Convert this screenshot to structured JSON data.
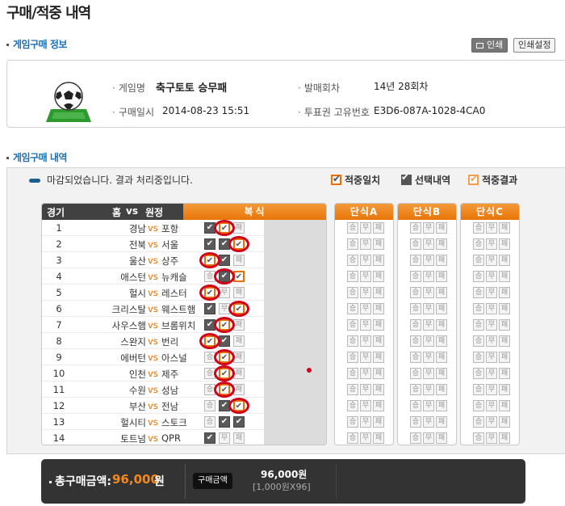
{
  "page_title": "구매/적중 내역",
  "section_purchase_info": "게임구매 정보",
  "btn_print": "인쇄",
  "btn_print_setup": "인쇄설정",
  "info": {
    "game_name_label": "게임명",
    "game_name_value": "축구토토 승무패",
    "round_label": "발매회차",
    "round_value": "14년 28회차",
    "purchase_date_label": "구매일시",
    "purchase_date_value": "2014-08-23 15:51",
    "ticket_id_label": "투표권 고유번호",
    "ticket_id_value": "E3D6-087A-1028-4CA0"
  },
  "section_purchase_detail": "게임구매 내역",
  "notice": "마감되었습니다. 결과 처리중입니다.",
  "legend": {
    "hit": "적중일치",
    "selected": "선택내역",
    "hit_result": "적중결과"
  },
  "table": {
    "col_no": "경기",
    "col_home": "홈",
    "col_vs": "vs",
    "col_away": "원정",
    "col_multi": "복식",
    "col_single_a": "단식A",
    "col_single_b": "단식B",
    "col_single_c": "단식C",
    "vs_text": "vs",
    "mark_win": "승",
    "mark_draw": "무",
    "mark_loss": "패"
  },
  "rows": [
    {
      "no": "1",
      "home": "경남",
      "away": "포항",
      "marks": [
        "sel",
        "hit",
        "empty"
      ],
      "circle": 1
    },
    {
      "no": "2",
      "home": "전북",
      "away": "서울",
      "marks": [
        "sel",
        "sel",
        "hit"
      ],
      "circle": 2
    },
    {
      "no": "3",
      "home": "울산",
      "away": "상주",
      "marks": [
        "hit",
        "sel",
        "empty"
      ],
      "circle": 0
    },
    {
      "no": "4",
      "home": "애스턴",
      "away": "뉴캐슬",
      "marks": [
        "empty",
        "sel",
        "hit"
      ],
      "circle": 1
    },
    {
      "no": "5",
      "home": "헐시",
      "away": "레스터",
      "marks": [
        "hit",
        "empty",
        "empty"
      ],
      "circle": 0
    },
    {
      "no": "6",
      "home": "크리스탈",
      "away": "웨스트햄",
      "marks": [
        "sel",
        "empty",
        "hit"
      ],
      "circle": 2
    },
    {
      "no": "7",
      "home": "사우스햄",
      "away": "브롬위치",
      "marks": [
        "sel",
        "hit",
        "empty"
      ],
      "circle": 1
    },
    {
      "no": "8",
      "home": "스완지",
      "away": "번리",
      "marks": [
        "hit",
        "sel",
        "empty"
      ],
      "circle": 0
    },
    {
      "no": "9",
      "home": "에버턴",
      "away": "아스널",
      "marks": [
        "empty",
        "hit",
        "empty"
      ],
      "circle": 1
    },
    {
      "no": "10",
      "home": "인천",
      "away": "제주",
      "marks": [
        "empty",
        "hit",
        "empty"
      ],
      "circle": 1
    },
    {
      "no": "11",
      "home": "수원",
      "away": "성남",
      "marks": [
        "empty",
        "hit",
        "empty"
      ],
      "circle": 1
    },
    {
      "no": "12",
      "home": "부산",
      "away": "전남",
      "marks": [
        "empty",
        "sel",
        "hit"
      ],
      "circle": 2
    },
    {
      "no": "13",
      "home": "헐시티",
      "away": "스토크",
      "marks": [
        "empty",
        "sel",
        "sel"
      ],
      "circle": -1
    },
    {
      "no": "14",
      "home": "토트넘",
      "away": "QPR",
      "marks": [
        "sel",
        "empty",
        "empty"
      ],
      "circle": -1
    }
  ],
  "total": {
    "label": "총구매금액:",
    "amount": "96,000",
    "unit": "원",
    "badge": "구매금액",
    "value": "96,000원",
    "breakdown": "[1,000원X96]"
  },
  "colors": {
    "accent_orange": "#e87000",
    "link_blue": "#1a6fb5",
    "mark_circle": "#d0021b",
    "dark_bar": "#333333"
  }
}
